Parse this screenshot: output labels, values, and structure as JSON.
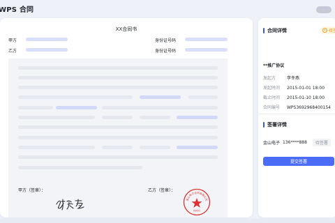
{
  "app": {
    "title": "WPS 合同"
  },
  "document": {
    "title": "XX合同书",
    "party_a_label": "甲方",
    "party_b_label": "乙方",
    "id_label_1": "身份证号码",
    "id_label_2": "身份证号码",
    "sign_a_label": "甲方（签章）：",
    "sign_b_label": "乙方（签章）：",
    "signature": "李冬燕",
    "seal": {
      "ring_text": "金山电子合同有限公司",
      "code": "00001",
      "color": "#e03030"
    }
  },
  "details": {
    "heading": "合同详情",
    "status": "待签",
    "status_icon": "clock-icon",
    "contract_name": "**推广协议",
    "rows": [
      {
        "key": "发起方",
        "value": "李冬燕"
      },
      {
        "key": "发起时间",
        "value": "2015-01-01 18:00"
      },
      {
        "key": "截止时间",
        "value": "2015-01-10 18:00"
      },
      {
        "key": "合同编号",
        "value": "WPS3692968400154"
      }
    ]
  },
  "signing": {
    "heading": "签署详情",
    "signer_name": "金山电子",
    "signer_phone": "136****888",
    "signer_status": "待签署",
    "submit_label": "提交签署"
  },
  "colors": {
    "accent": "#4a6cf7",
    "section_bar": "#3b5bdb",
    "placeholder": "#d9defa",
    "status_bg": "#fff6e3",
    "status_fg": "#e89a10",
    "seal_red": "#e03030"
  }
}
